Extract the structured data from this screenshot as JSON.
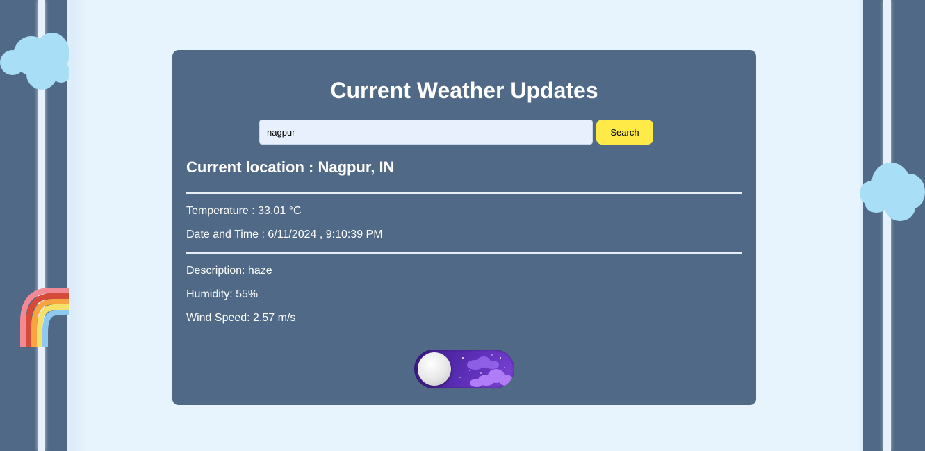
{
  "app": {
    "title": "Current Weather Updates"
  },
  "search": {
    "value": "nagpur",
    "placeholder": "",
    "button_label": "Search"
  },
  "location": {
    "text": "Current location : Nagpur, IN"
  },
  "weather": {
    "temperature": "Temperature : 33.01 °C",
    "datetime": "Date and Time : 6/11/2024 , 9:10:39 PM",
    "description": "Description: haze",
    "humidity": "Humidity: 55%",
    "wind": "Wind Speed: 2.57 m/s"
  },
  "theme_toggle": {
    "state": "night"
  },
  "colors": {
    "card": "#4f6986",
    "page": "#e8f4fd",
    "search_button": "#ffea47",
    "toggle_night": "#5e2fb8"
  },
  "icons": [
    "cloud-icon",
    "rainbow-icon",
    "moon-knob-icon",
    "night-clouds-icon",
    "stars-icon"
  ]
}
